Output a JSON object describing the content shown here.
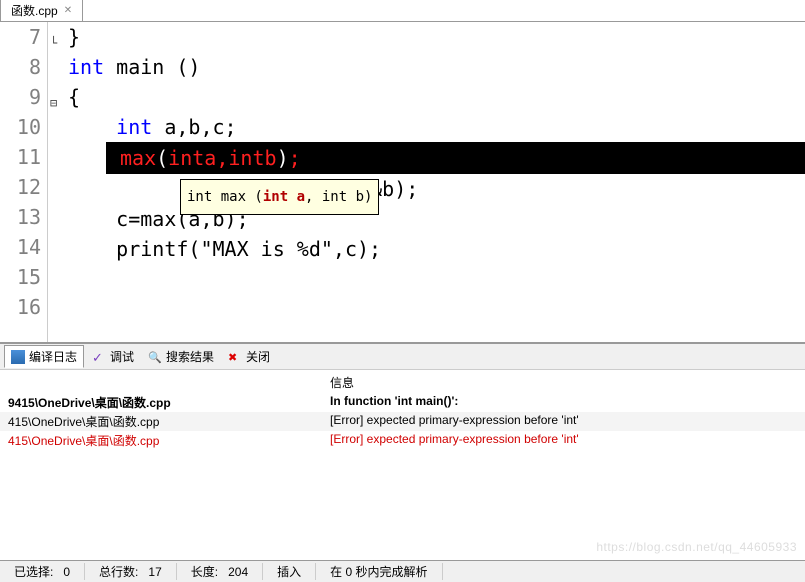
{
  "tab": {
    "title": "函数.cpp"
  },
  "lines": {
    "l7": "7",
    "l8": "8",
    "l9": "9",
    "l10": "10",
    "l11": "11",
    "l12": "12",
    "l13": "13",
    "l14": "14",
    "l15": "15",
    "l16": "16"
  },
  "fold": {
    "l7": "└",
    "l9": "⊟"
  },
  "code": {
    "l7": "}",
    "l8_kw": "int",
    "l8_rest": " main ()",
    "l9": "{",
    "l10_pad": "    ",
    "l10_kw": "int",
    "l10_rest": " a,b,c;",
    "l11_pad": "",
    "l11_max": "max ",
    "l11_p1": "(",
    "l11_t1": "int",
    "l11_a": " a,",
    "l11_t2": "int",
    "l11_b": " b",
    "l11_p2": ")",
    "l11_semi": ";",
    "l12_rest": "&a,&b);",
    "l13": "    c=max(a,b);",
    "l14": "    printf(\"MAX is %d\",c);",
    "l15": "",
    "l16": ""
  },
  "tooltip": {
    "t1": "int max (",
    "kw1": "int a",
    "mid": ", int b)",
    "full_prefix": "int max (",
    "full_suffix": ")"
  },
  "btabs": {
    "log": "编译日志",
    "debug": "调试",
    "search": "搜索结果",
    "close": "关闭"
  },
  "msg": {
    "header": "信息",
    "rows": [
      {
        "file": "9415\\OneDrive\\桌面\\函数.cpp",
        "info": "In function 'int main()':",
        "bold": true
      },
      {
        "file": "415\\OneDrive\\桌面\\函数.cpp",
        "info": "[Error] expected primary-expression before 'int'",
        "alt": true
      },
      {
        "file": "415\\OneDrive\\桌面\\函数.cpp",
        "info": "[Error] expected primary-expression before 'int'",
        "red": true
      }
    ]
  },
  "status": {
    "sel_label": "已选择:",
    "sel_val": "0",
    "lines_label": "总行数:",
    "lines_val": "17",
    "len_label": "长度:",
    "len_val": "204",
    "mode": "插入",
    "parse": "在 0 秒内完成解析"
  },
  "watermark": "https://blog.csdn.net/qq_44605933"
}
